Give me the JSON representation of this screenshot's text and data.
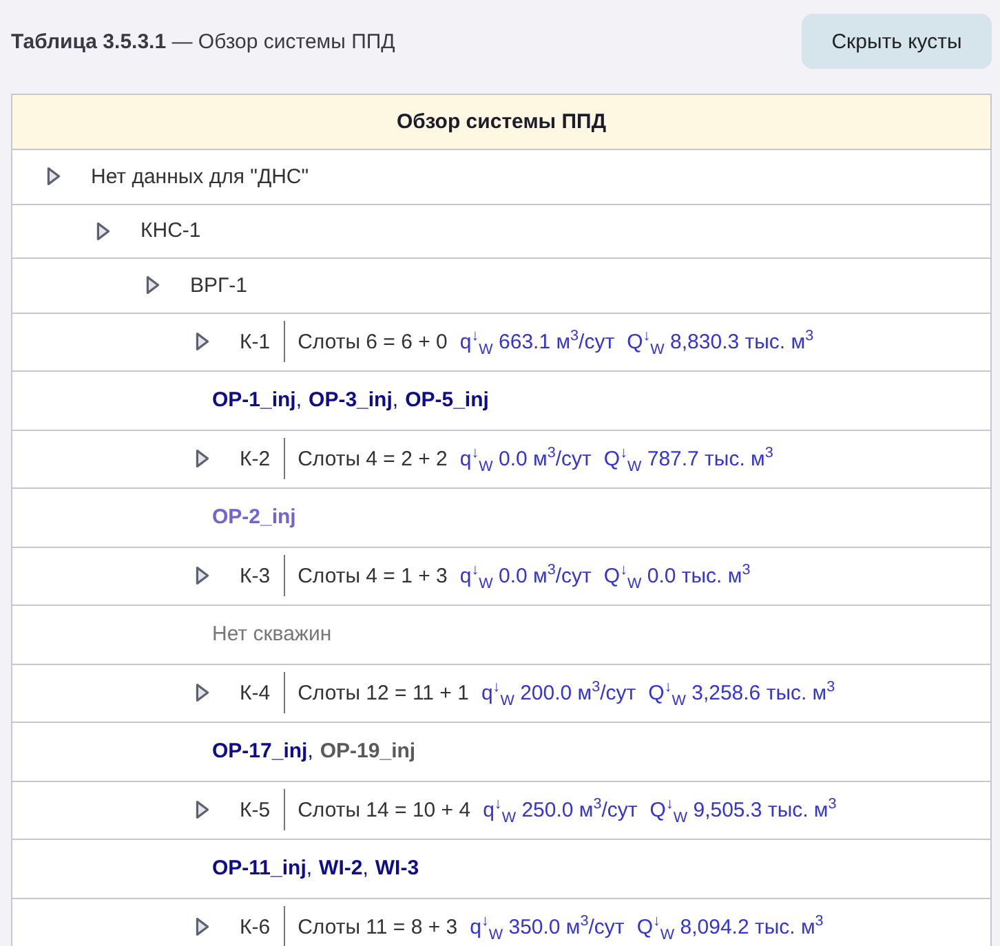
{
  "caption": "**Таблица 3.5.3.1** — Обзор системы ППД",
  "hide_button": "Скрыть кусты",
  "table": {
    "header": "Обзор системы ППД",
    "tree": [
      {
        "kind": "group",
        "label": "Нет данных для \"ДНС\"",
        "children": [
          {
            "kind": "group",
            "label": "КНС-1",
            "children": [
              {
                "kind": "group",
                "label": "ВРГ-1",
                "children": [
                  {
                    "kind": "pad",
                    "name": "К-1",
                    "slots": "Слоты 6 = 6 + 0",
                    "rate": "q$^{↓}$$_{W}$ 663.1 м$^{3}$/сут",
                    "total": "Q$^{↓}$$_{W}$ 8,830.3 тыс. м$^{3}$",
                    "wells": [
                      {
                        "name": "OP-1_inj",
                        "punct": ",",
                        "color": "#0c0c8c"
                      },
                      {
                        "name": "OP-3_inj",
                        "punct": ",",
                        "color": "#0c0c8c"
                      },
                      {
                        "name": "OP-5_inj",
                        "color": "#0c0c8c"
                      }
                    ]
                  },
                  {
                    "kind": "pad",
                    "name": "К-2",
                    "slots": "Слоты 4 = 2 + 2",
                    "rate": "q$^{↓}$$_{W}$ 0.0 м$^{3}$/сут",
                    "total": "Q$^{↓}$$_{W}$ 787.7 тыс. м$^{3}$",
                    "wells": [
                      {
                        "name": "OP-2_inj",
                        "color": "#7264d2"
                      }
                    ]
                  },
                  {
                    "kind": "pad",
                    "name": "К-3",
                    "slots": "Слоты 4 = 1 + 3",
                    "rate": "q$^{↓}$$_{W}$ 0.0 м$^{3}$/сут",
                    "total": "Q$^{↓}$$_{W}$ 0.0 тыс. м$^{3}$",
                    "note": "Нет скважин"
                  },
                  {
                    "kind": "pad",
                    "name": "К-4",
                    "slots": "Слоты 12 = 11 + 1",
                    "rate": "q$^{↓}$$_{W}$ 200.0 м$^{3}$/сут",
                    "total": "Q$^{↓}$$_{W}$ 3,258.6 тыс. м$^{3}$",
                    "wells": [
                      {
                        "name": "OP-17_inj",
                        "punct": ",",
                        "color": "#0c0c8c"
                      },
                      {
                        "name": "OP-19_inj",
                        "color": "#5a5a5a"
                      }
                    ]
                  },
                  {
                    "kind": "pad",
                    "name": "К-5",
                    "slots": "Слоты 14 = 10 + 4",
                    "rate": "q$^{↓}$$_{W}$ 250.0 м$^{3}$/сут",
                    "total": "Q$^{↓}$$_{W}$ 9,505.3 тыс. м$^{3}$",
                    "wells": [
                      {
                        "name": "OP-11_inj",
                        "punct": ",",
                        "color": "#0c0c8c"
                      },
                      {
                        "name": "WI-2",
                        "punct": ",",
                        "color": "#0c0c8c"
                      },
                      {
                        "name": "WI-3",
                        "color": "#0c0c8c"
                      }
                    ]
                  },
                  {
                    "kind": "pad",
                    "name": "К-6",
                    "slots": "Слоты 11 = 8 + 3",
                    "rate": "q$^{↓}$$_{W}$ 350.0 м$^{3}$/сут",
                    "total": "Q$^{↓}$$_{W}$ 8,094.2 тыс. м$^{3}$"
                  }
                ]
              }
            ]
          }
        ]
      }
    ]
  }
}
